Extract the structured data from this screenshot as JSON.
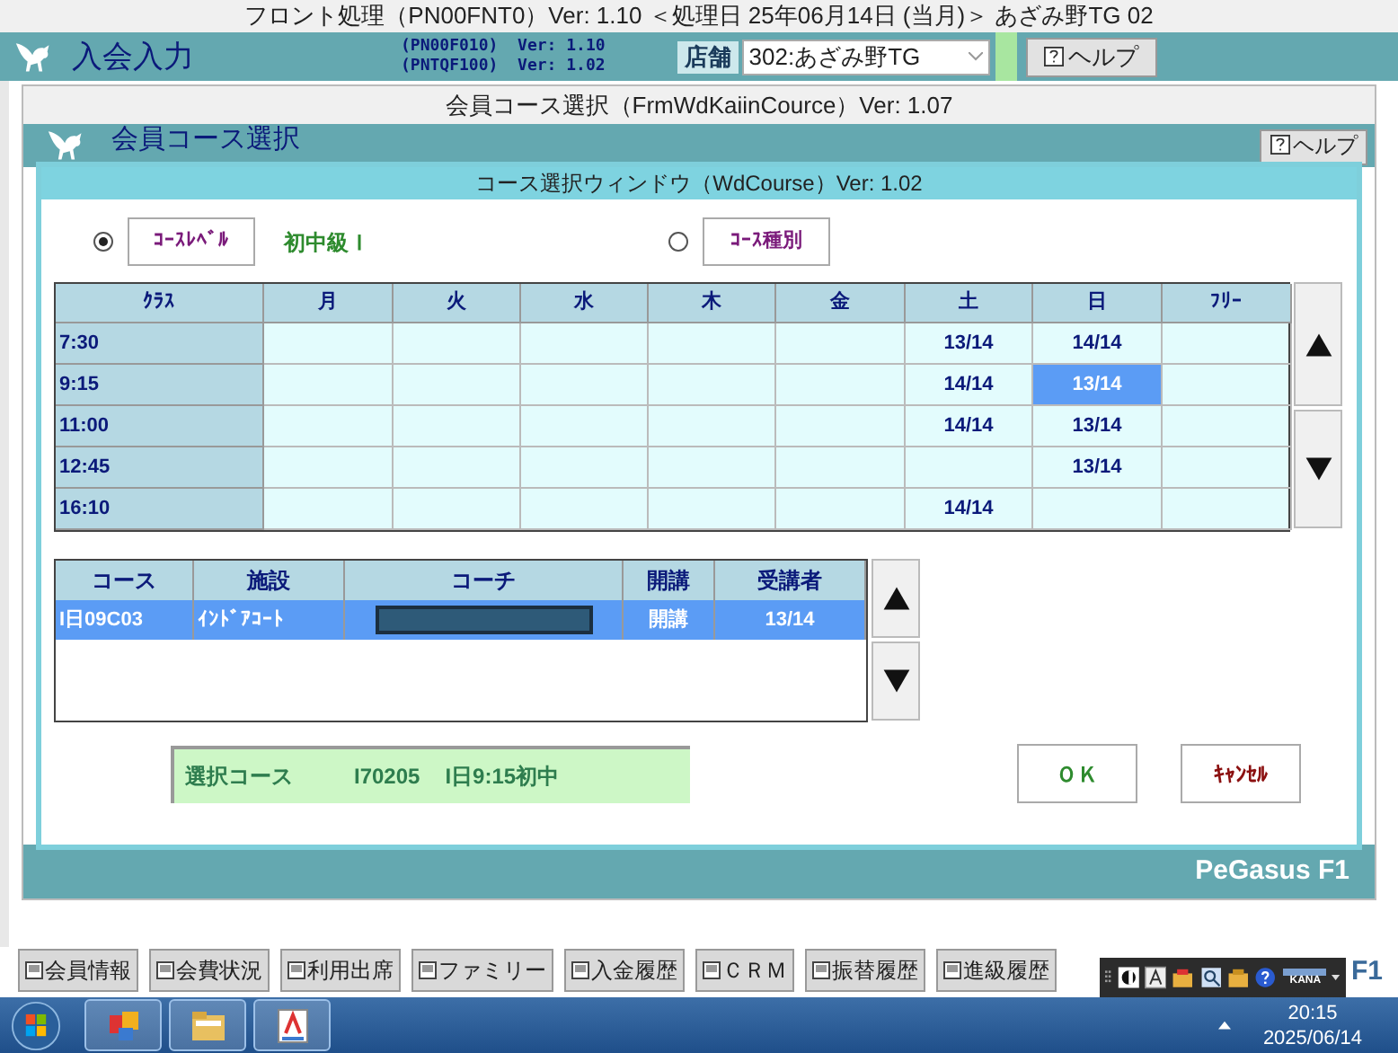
{
  "app_title": "フロント処理（PN00FNT0）Ver: 1.10 ＜処理日 25年06月14日 (当月)＞ あざみ野TG 02",
  "main_header": {
    "title": "入会入力",
    "versions": [
      "(PN00F010)  Ver: 1.10",
      "(PNTQF100)  Ver: 1.02"
    ],
    "store_label": "店舗",
    "store_value": "302:あざみ野TG",
    "help": "ヘルプ"
  },
  "course_window": {
    "title": "会員コース選択（FrmWdKaiinCource）Ver: 1.07",
    "header": "会員コース選択",
    "help": "ヘルプ",
    "footer": "PeGasus F1"
  },
  "dialog": {
    "title": "コース選択ウィンドウ（WdCourse）Ver: 1.02",
    "modes": [
      {
        "label": "ｺｰｽﾚﾍﾞﾙ",
        "selected": true,
        "value": "初中級Ｉ"
      },
      {
        "label": "ｺｰｽ種別",
        "selected": false
      }
    ],
    "schedule": {
      "columns": [
        "ｸﾗｽ",
        "月",
        "火",
        "水",
        "木",
        "金",
        "土",
        "日",
        "ﾌﾘｰ"
      ],
      "rows": [
        {
          "cells": [
            {
              "kind": "time",
              "text": "7:30"
            },
            {
              "selected": false
            },
            {
              "selected": false
            },
            {
              "selected": false
            },
            {
              "selected": false
            },
            {
              "selected": false
            },
            {
              "text": "13/14",
              "selected": false
            },
            {
              "text": "14/14",
              "selected": false
            },
            {
              "selected": false
            }
          ]
        },
        {
          "cells": [
            {
              "kind": "time",
              "text": "9:15"
            },
            {
              "selected": false
            },
            {
              "selected": false
            },
            {
              "selected": false
            },
            {
              "selected": false
            },
            {
              "selected": false
            },
            {
              "text": "14/14",
              "selected": false
            },
            {
              "text": "13/14",
              "selected": true
            },
            {
              "selected": false
            }
          ]
        },
        {
          "cells": [
            {
              "kind": "time",
              "text": "11:00"
            },
            {
              "selected": false
            },
            {
              "selected": false
            },
            {
              "selected": false
            },
            {
              "selected": false
            },
            {
              "selected": false
            },
            {
              "text": "14/14",
              "selected": false
            },
            {
              "text": "13/14",
              "selected": false
            },
            {
              "selected": false
            }
          ]
        },
        {
          "cells": [
            {
              "kind": "time",
              "text": "12:45"
            },
            {
              "selected": false
            },
            {
              "selected": false
            },
            {
              "selected": false
            },
            {
              "selected": false
            },
            {
              "selected": false
            },
            {
              "selected": false
            },
            {
              "text": "13/14",
              "selected": false
            },
            {
              "selected": false
            }
          ]
        },
        {
          "cells": [
            {
              "kind": "time",
              "text": "16:10"
            },
            {
              "selected": false
            },
            {
              "selected": false
            },
            {
              "selected": false
            },
            {
              "selected": false
            },
            {
              "selected": false
            },
            {
              "text": "14/14",
              "selected": false
            },
            {
              "selected": false
            },
            {
              "selected": false
            }
          ]
        }
      ]
    },
    "courses": {
      "columns": [
        "コース",
        "施設",
        "コーチ",
        "開講",
        "受講者"
      ],
      "rows": [
        {
          "selected": true,
          "cells": [
            {
              "text": "I日09C03"
            },
            {
              "text": "ｲﾝﾄﾞｱｺｰﾄ"
            },
            {
              "redacted": true
            },
            {
              "text": "開講"
            },
            {
              "text": "13/14"
            }
          ]
        }
      ]
    },
    "selection": {
      "label": "選択コース",
      "code": "I70205",
      "name": "I日9:15初中"
    },
    "buttons": [
      {
        "label": "ＯＫ",
        "kind": "ok"
      },
      {
        "label": "ｷｬﾝｾﾙ",
        "kind": "cancel"
      }
    ]
  },
  "function_buttons": [
    "会員情報",
    "会費状況",
    "利用出席",
    "ファミリー",
    "入金履歴",
    "ＣＲＭ",
    "振替履歴",
    "進級履歴"
  ],
  "corner_label": "F1",
  "language_bar": {
    "mode": "KANA"
  },
  "taskbar": {
    "time": "20:15",
    "date": "2025/06/14"
  }
}
